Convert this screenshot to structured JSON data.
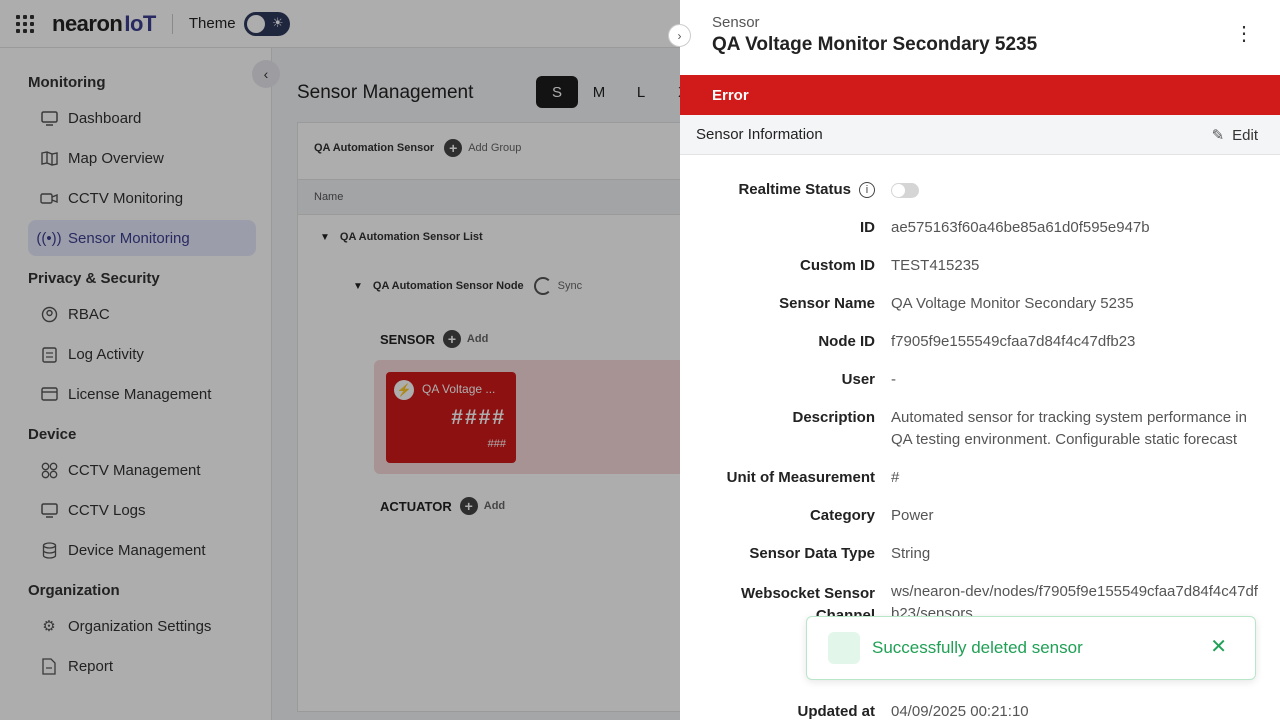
{
  "app": {
    "brand": "nearon",
    "brand_suffix": "IoT",
    "theme_label": "Theme"
  },
  "sidebar": {
    "sections": [
      {
        "title": "Monitoring",
        "items": [
          {
            "label": "Dashboard",
            "icon": "monitor-icon"
          },
          {
            "label": "Map Overview",
            "icon": "map-icon"
          },
          {
            "label": "CCTV Monitoring",
            "icon": "camera-icon"
          },
          {
            "label": "Sensor Monitoring",
            "icon": "signal-icon",
            "active": true
          }
        ]
      },
      {
        "title": "Privacy & Security",
        "items": [
          {
            "label": "RBAC",
            "icon": "rbac-icon"
          },
          {
            "label": "Log Activity",
            "icon": "clipboard-icon"
          },
          {
            "label": "License Management",
            "icon": "card-icon"
          }
        ]
      },
      {
        "title": "Device",
        "items": [
          {
            "label": "CCTV Management",
            "icon": "grid-icon"
          },
          {
            "label": "CCTV Logs",
            "icon": "monitor-icon"
          },
          {
            "label": "Device Management",
            "icon": "database-icon"
          }
        ]
      },
      {
        "title": "Organization",
        "items": [
          {
            "label": "Organization Settings",
            "icon": "gear-icon"
          },
          {
            "label": "Report",
            "icon": "report-icon"
          }
        ]
      }
    ]
  },
  "main": {
    "title": "Sensor Management",
    "size_tabs": [
      "S",
      "M",
      "L",
      "X"
    ],
    "group_name": "QA Automation Sensor",
    "add_group": "Add Group",
    "name_header": "Name",
    "sensor_list": "QA Automation Sensor List",
    "sensor_node": "QA Automation Sensor Node",
    "sync_label": "Sync",
    "sensor_label": "SENSOR",
    "actuator_label": "ACTUATOR",
    "add_label": "Add",
    "card": {
      "name": "QA Voltage ...",
      "value": "####",
      "unit": "###"
    }
  },
  "drawer": {
    "subtitle": "Sensor",
    "title": "QA Voltage Monitor Secondary 5235",
    "status": "Error",
    "section_title": "Sensor Information",
    "edit_label": "Edit",
    "realtime_label": "Realtime Status",
    "realtime_on": false,
    "fields": {
      "id": {
        "label": "ID",
        "value": "ae575163f60a46be85a61d0f595e947b"
      },
      "custom_id": {
        "label": "Custom ID",
        "value": "TEST415235"
      },
      "sensor_name": {
        "label": "Sensor Name",
        "value": "QA Voltage Monitor Secondary 5235"
      },
      "node_id": {
        "label": "Node ID",
        "value": "f7905f9e155549cfaa7d84f4c47dfb23"
      },
      "user": {
        "label": "User",
        "value": "-"
      },
      "description": {
        "label": "Description",
        "value": "Automated sensor for tracking system performance in QA testing environment. Configurable static forecast"
      },
      "unit": {
        "label": "Unit of Measurement",
        "value": "#"
      },
      "category": {
        "label": "Category",
        "value": "Power"
      },
      "data_type": {
        "label": "Sensor Data Type",
        "value": "String"
      },
      "ws_channel": {
        "label": "Websocket Sensor Channel",
        "value": "ws/nearon-dev/nodes/f7905f9e155549cfaa7d84f4c47dfb23/sensors"
      },
      "updated_at": {
        "label": "Updated at",
        "value": "04/09/2025 00:21:10"
      }
    }
  },
  "toast": {
    "message": "Successfully deleted sensor"
  }
}
